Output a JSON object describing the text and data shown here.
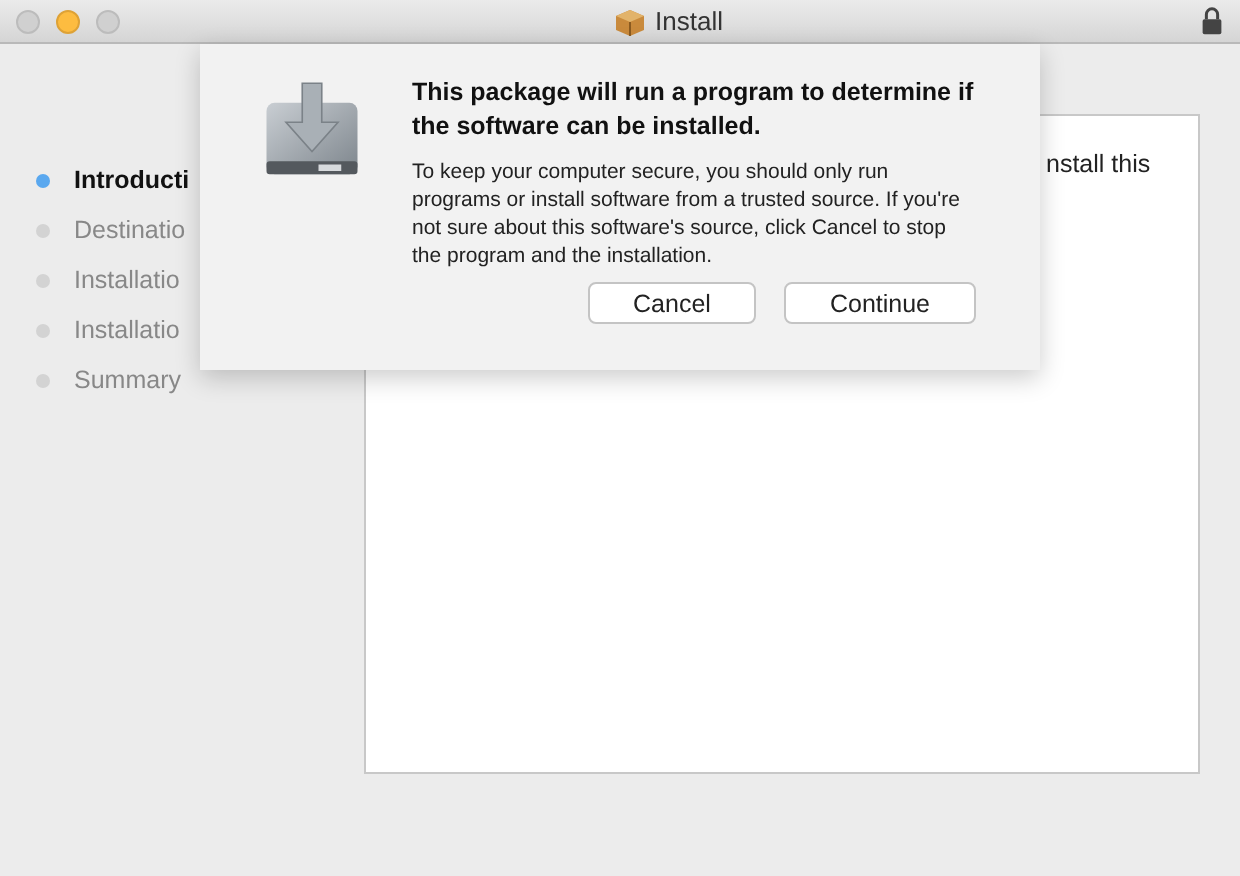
{
  "window": {
    "title": "Install"
  },
  "steps": [
    {
      "label": "Introducti",
      "selected": true
    },
    {
      "label": "Destinatio",
      "selected": false
    },
    {
      "label": "Installatio",
      "selected": false
    },
    {
      "label": "Installatio",
      "selected": false
    },
    {
      "label": "Summary",
      "selected": false
    }
  ],
  "content": {
    "text": "nstall this"
  },
  "sheet": {
    "heading": "This package will run a program to determine if the software can be installed.",
    "message": "To keep your computer secure, you should only run programs or install software from a trusted source. If you're not sure about this software's source, click Cancel to stop the program and the installation.",
    "buttons": [
      "Cancel",
      "Continue"
    ]
  }
}
